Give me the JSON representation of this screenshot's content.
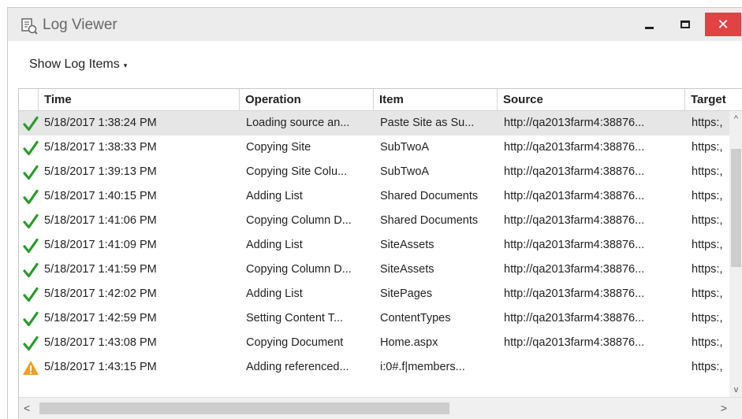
{
  "window": {
    "title": "Log Viewer",
    "minimize_icon": "minimize-icon",
    "maximize_icon": "maximize-icon",
    "close_icon": "close-icon",
    "close_glyph": "✕",
    "close_color": "#e04343"
  },
  "toolbar": {
    "show_log_label": "Show Log Items",
    "caret_glyph": "▾"
  },
  "table": {
    "columns": [
      "Time",
      "Operation",
      "Item",
      "Source",
      "Target"
    ],
    "rows": [
      {
        "status": "success",
        "time": "5/18/2017 1:38:24 PM",
        "operation": "Loading source an...",
        "item": "Paste Site as Su...",
        "source": "http://qa2013farm4:38876...",
        "target": "https:,"
      },
      {
        "status": "success",
        "time": "5/18/2017 1:38:33 PM",
        "operation": "Copying Site",
        "item": "SubTwoA",
        "source": "http://qa2013farm4:38876...",
        "target": "https:,"
      },
      {
        "status": "success",
        "time": "5/18/2017 1:39:13 PM",
        "operation": "Copying Site Colu...",
        "item": "SubTwoA",
        "source": "http://qa2013farm4:38876...",
        "target": "https:,"
      },
      {
        "status": "success",
        "time": "5/18/2017 1:40:15 PM",
        "operation": "Adding List",
        "item": "Shared Documents",
        "source": "http://qa2013farm4:38876...",
        "target": "https:,"
      },
      {
        "status": "success",
        "time": "5/18/2017 1:41:06 PM",
        "operation": "Copying Column D...",
        "item": "Shared Documents",
        "source": "http://qa2013farm4:38876...",
        "target": "https:,"
      },
      {
        "status": "success",
        "time": "5/18/2017 1:41:09 PM",
        "operation": "Adding List",
        "item": "SiteAssets",
        "source": "http://qa2013farm4:38876...",
        "target": "https:,"
      },
      {
        "status": "success",
        "time": "5/18/2017 1:41:59 PM",
        "operation": "Copying Column D...",
        "item": "SiteAssets",
        "source": "http://qa2013farm4:38876...",
        "target": "https:,"
      },
      {
        "status": "success",
        "time": "5/18/2017 1:42:02 PM",
        "operation": "Adding List",
        "item": "SitePages",
        "source": "http://qa2013farm4:38876...",
        "target": "https:,"
      },
      {
        "status": "success",
        "time": "5/18/2017 1:42:59 PM",
        "operation": "Setting Content T...",
        "item": "ContentTypes",
        "source": "http://qa2013farm4:38876...",
        "target": "https:,"
      },
      {
        "status": "success",
        "time": "5/18/2017 1:43:08 PM",
        "operation": "Copying Document",
        "item": "Home.aspx",
        "source": "http://qa2013farm4:38876...",
        "target": "https:,"
      },
      {
        "status": "warning",
        "time": "5/18/2017 1:43:15 PM",
        "operation": "Adding referenced...",
        "item": "i:0#.f|members...",
        "source": "",
        "target": "https:,"
      }
    ]
  },
  "scrollbars": {
    "up_glyph": "^",
    "down_glyph": "v",
    "left_glyph": "<",
    "right_glyph": ">"
  },
  "colors": {
    "success": "#2a9a2a",
    "warning": "#f0a020",
    "selected_row": "#e6e6e6"
  }
}
